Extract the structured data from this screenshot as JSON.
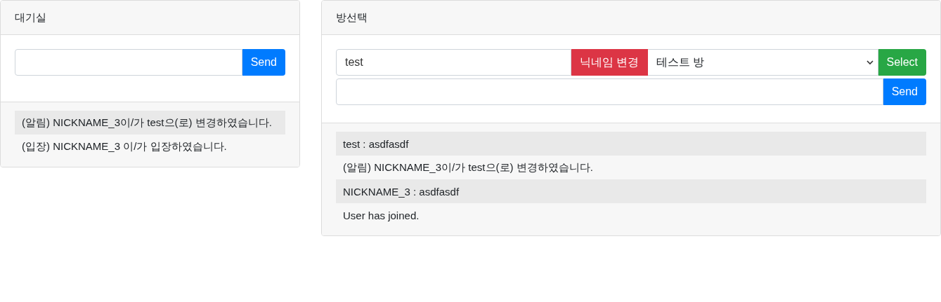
{
  "lobby": {
    "title": "대기실",
    "send_button": "Send",
    "messages": [
      "(알림) NICKNAME_3이/가 test으(로) 변경하였습니다.",
      "(입장) NICKNAME_3 이/가 입장하였습니다."
    ]
  },
  "room": {
    "title": "방선택",
    "nickname_input": {
      "value": "test"
    },
    "nickname_button": "닉네임 변경",
    "room_select": {
      "value": "테스트 방"
    },
    "select_button": "Select",
    "send_button": "Send",
    "messages": [
      "test : asdfasdf",
      "(알림) NICKNAME_3이/가 test으(로) 변경하였습니다.",
      "NICKNAME_3 : asdfasdf",
      "User has joined."
    ]
  }
}
